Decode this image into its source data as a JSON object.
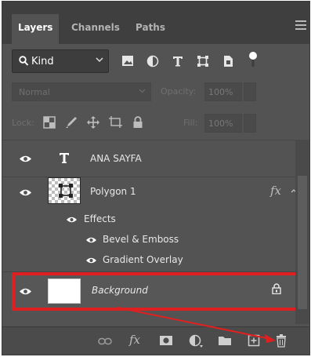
{
  "tabs": [
    {
      "label": "Layers",
      "active": true
    },
    {
      "label": "Channels",
      "active": false
    },
    {
      "label": "Paths",
      "active": false
    }
  ],
  "filter": {
    "kind_label": "Kind",
    "icons": [
      "image-filter-icon",
      "adjustment-filter-icon",
      "type-filter-icon",
      "shape-filter-icon",
      "smart-object-filter-icon",
      "filter-toggle-icon"
    ]
  },
  "blend": {
    "mode": "Normal",
    "opacity_label": "Opacity:",
    "opacity_value": "100%"
  },
  "lock": {
    "label": "Lock:",
    "fill_label": "Fill:",
    "fill_value": "100%"
  },
  "layers": [
    {
      "name": "ANA SAYFA",
      "type": "text",
      "visible": true
    },
    {
      "name": "Polygon 1",
      "type": "shape",
      "visible": true,
      "fx": "fx",
      "effects_label": "Effects",
      "effects": [
        "Bevel & Emboss",
        "Gradient Overlay"
      ]
    },
    {
      "name": "Background",
      "type": "background",
      "visible": true,
      "locked": true,
      "highlighted": true
    }
  ],
  "bottom_icons": [
    "link-layers-icon",
    "fx-icon",
    "add-mask-icon",
    "adjustment-layer-icon",
    "new-group-icon",
    "new-layer-icon",
    "delete-layer-icon"
  ],
  "bottom_fx": "fx",
  "colors": {
    "panel_bg": "#535353",
    "tab_bar_bg": "#3f3f3f",
    "highlight_border": "#e02020",
    "annotation_arrow": "#e02020"
  }
}
